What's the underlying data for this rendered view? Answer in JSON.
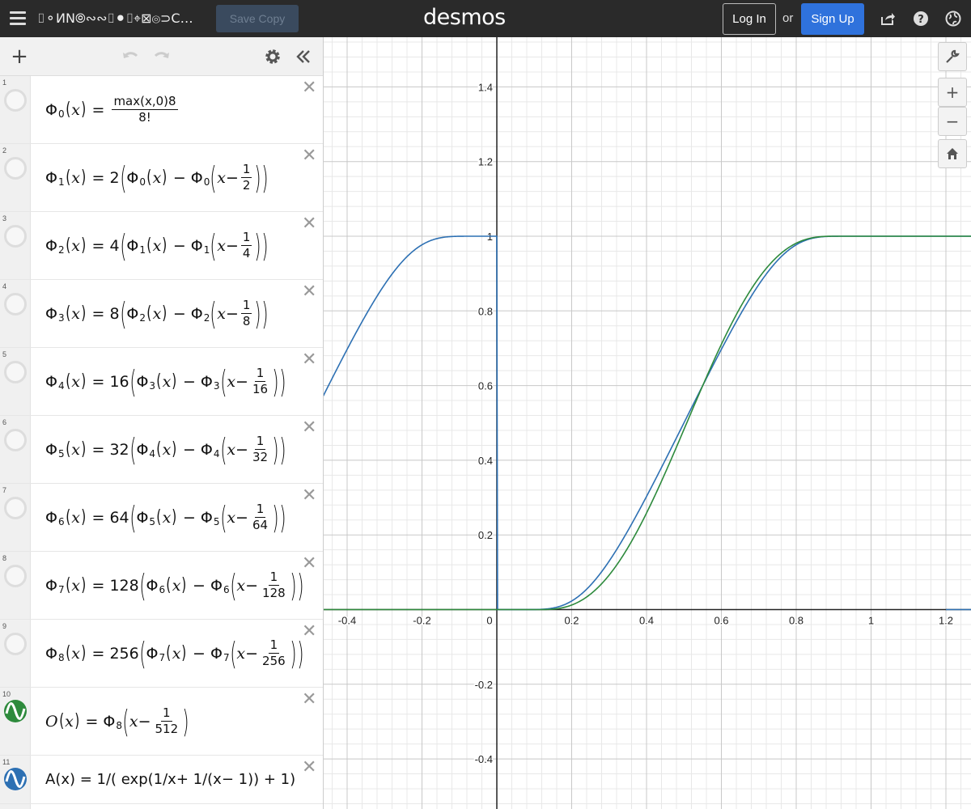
{
  "header": {
    "graph_title": "⌷⚬ИN⦾∾∾⌷⚫⌷⌖⊠⦾⊃C…",
    "save_copy": "Save Copy",
    "brand": "desmos",
    "log_in": "Log In",
    "or": "or",
    "sign_up": "Sign Up"
  },
  "expressions": [
    {
      "num": "1",
      "lhs_fn": "Φ",
      "lhs_sub": "0",
      "lhs_arg": "x",
      "max_text": "max(x,0)8",
      "den_text": "8!"
    },
    {
      "num": "2",
      "coef": "2",
      "inner_sub": "0",
      "outer_sub": "1",
      "frac_num": "1",
      "frac_den": "2"
    },
    {
      "num": "3",
      "coef": "4",
      "inner_sub": "1",
      "outer_sub": "2",
      "frac_num": "1",
      "frac_den": "4"
    },
    {
      "num": "4",
      "coef": "8",
      "inner_sub": "2",
      "outer_sub": "3",
      "frac_num": "1",
      "frac_den": "8"
    },
    {
      "num": "5",
      "coef": "16",
      "inner_sub": "3",
      "outer_sub": "4",
      "frac_num": "1",
      "frac_den": "16"
    },
    {
      "num": "6",
      "coef": "32",
      "inner_sub": "4",
      "outer_sub": "5",
      "frac_num": "1",
      "frac_den": "32"
    },
    {
      "num": "7",
      "coef": "64",
      "inner_sub": "5",
      "outer_sub": "6",
      "frac_num": "1",
      "frac_den": "64"
    },
    {
      "num": "8",
      "coef": "128",
      "inner_sub": "6",
      "outer_sub": "7",
      "frac_num": "1",
      "frac_den": "128"
    },
    {
      "num": "9",
      "coef": "256",
      "inner_sub": "7",
      "outer_sub": "8",
      "frac_num": "1",
      "frac_den": "256"
    },
    {
      "num": "10",
      "lhs": "O",
      "sub": "8",
      "frac_num": "1",
      "frac_den": "512",
      "color": "#2d8a3c"
    },
    {
      "num": "11",
      "text": "A(x) = 1/( exp(1/x+ 1/(x− 1)) + 1)",
      "color": "#2d70b3"
    }
  ],
  "graph": {
    "x_ticks": [
      "-0.4",
      "-0.2",
      "0",
      "0.2",
      "0.4",
      "0.6",
      "0.8",
      "1",
      "1.2"
    ],
    "y_ticks": [
      "1.4",
      "1.2",
      "1",
      "0.8",
      "0.6",
      "0.4",
      "0.2",
      "-0.2",
      "-0.4"
    ],
    "colors": {
      "O": "#2d8a3c",
      "A": "#2d70b3"
    }
  }
}
